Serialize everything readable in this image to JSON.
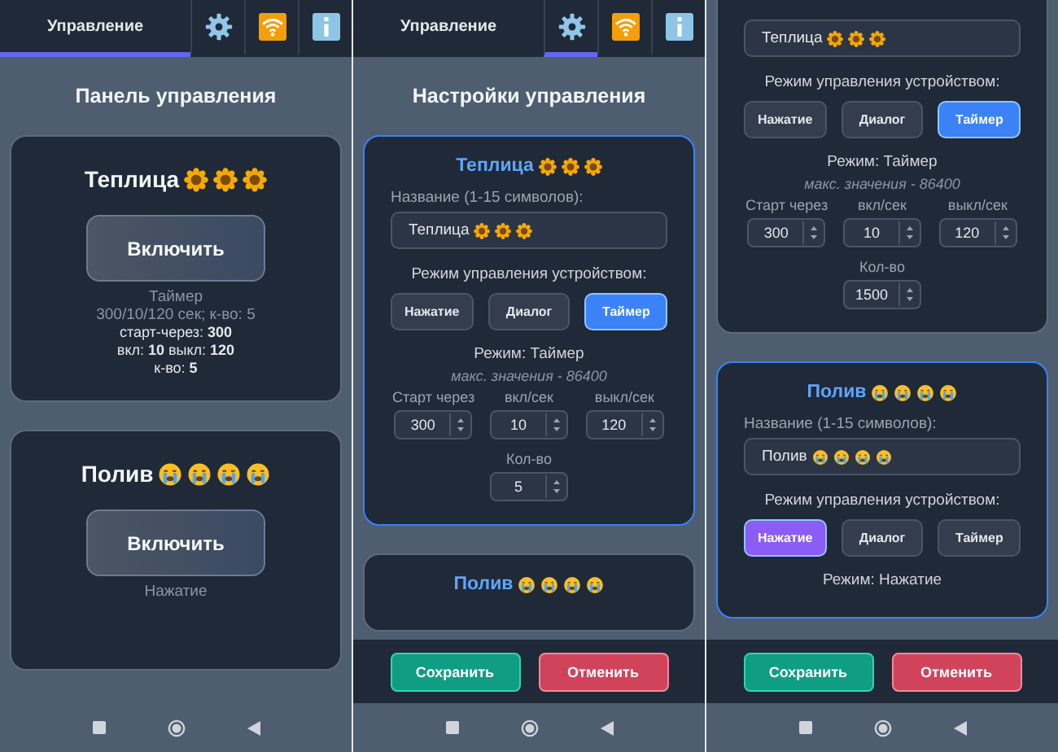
{
  "screens": [
    {
      "kind": "panel",
      "tabs": [
        {
          "kind": "text",
          "label": "Управление",
          "selected": true
        },
        {
          "kind": "gear",
          "selected": false
        },
        {
          "kind": "wifi",
          "selected": false
        },
        {
          "kind": "info",
          "selected": false
        }
      ],
      "title": "Панель управления",
      "devices": [
        {
          "name": "Теплица",
          "emoji": [
            {
              "kind": "sunflower"
            },
            {
              "kind": "sunflower"
            },
            {
              "kind": "sunflower"
            }
          ],
          "button": "Включить",
          "mode": "Таймер",
          "summary": "300/10/120 сек; к-во: 5",
          "details": [
            "старт-через: **300**",
            "вкл: **10** выкл: **120**",
            "к-во: **5**"
          ]
        },
        {
          "name": "Полив",
          "emoji": [
            {
              "kind": "crying"
            },
            {
              "kind": "crying"
            },
            {
              "kind": "crying"
            },
            {
              "kind": "crying"
            }
          ],
          "button": "Включить",
          "mode": "Нажатие"
        }
      ]
    },
    {
      "kind": "settings",
      "tabs": [
        {
          "kind": "text",
          "label": "Управление",
          "selected": false
        },
        {
          "kind": "gear",
          "selected": true
        },
        {
          "kind": "wifi",
          "selected": false
        },
        {
          "kind": "info",
          "selected": false
        }
      ],
      "title": "Настройки управления",
      "devices": [
        {
          "focused": true,
          "name": "Теплица",
          "emoji": [
            {
              "kind": "sunflower"
            },
            {
              "kind": "sunflower"
            },
            {
              "kind": "sunflower"
            }
          ],
          "name_label": "Название (1-15 символов):",
          "name_value": "Теплица",
          "name_value_emoji": [
            {
              "kind": "sunflower"
            },
            {
              "kind": "sunflower"
            },
            {
              "kind": "sunflower"
            }
          ],
          "mode_label": "Режим управления устройством:",
          "modes": [
            {
              "label": "Нажатие",
              "selected": false
            },
            {
              "label": "Диалог",
              "selected": false
            },
            {
              "label": "Таймер",
              "selected": true
            }
          ],
          "mode_text": "Режим: Таймер",
          "hint": "макс. значения - 86400",
          "fields": [
            {
              "label": "Старт через",
              "value": "300"
            },
            {
              "label": "вкл/сек",
              "value": "10"
            },
            {
              "label": "выкл/сек",
              "value": "120"
            }
          ],
          "count": {
            "label": "Кол-во",
            "value": "5"
          }
        },
        {
          "focused": false,
          "name": "Полив",
          "emoji": [
            {
              "kind": "crying"
            },
            {
              "kind": "crying"
            },
            {
              "kind": "crying"
            },
            {
              "kind": "crying"
            }
          ]
        }
      ],
      "footer": {
        "save": "Сохранить",
        "cancel": "Отменить"
      }
    },
    {
      "kind": "settings",
      "devices": [
        {
          "focused": false,
          "name_value": "Теплица",
          "name_value_emoji": [
            {
              "kind": "sunflower"
            },
            {
              "kind": "sunflower"
            },
            {
              "kind": "sunflower"
            }
          ],
          "mode_label": "Режим управления устройством:",
          "modes": [
            {
              "label": "Нажатие",
              "selected": false
            },
            {
              "label": "Диалог",
              "selected": false
            },
            {
              "label": "Таймер",
              "selected": true
            }
          ],
          "mode_text": "Режим: Таймер",
          "hint": "макс. значения - 86400",
          "fields": [
            {
              "label": "Старт через",
              "value": "300"
            },
            {
              "label": "вкл/сек",
              "value": "10"
            },
            {
              "label": "выкл/сек",
              "value": "120"
            }
          ],
          "count": {
            "label": "Кол-во",
            "value": "1500"
          }
        },
        {
          "focused": true,
          "name": "Полив",
          "emoji": [
            {
              "kind": "crying"
            },
            {
              "kind": "crying"
            },
            {
              "kind": "crying"
            },
            {
              "kind": "crying"
            }
          ],
          "name_label": "Название (1-15 символов):",
          "name_value": "Полив",
          "name_value_emoji": [
            {
              "kind": "crying"
            },
            {
              "kind": "crying"
            },
            {
              "kind": "crying"
            },
            {
              "kind": "crying"
            }
          ],
          "mode_label": "Режим управления устройством:",
          "modes": [
            {
              "label": "Нажатие",
              "selected": true
            },
            {
              "label": "Диалог",
              "selected": false
            },
            {
              "label": "Таймер",
              "selected": false
            }
          ],
          "mode_text": "Режим: Нажатие"
        }
      ],
      "footer": {
        "save": "Сохранить",
        "cancel": "Отменить"
      }
    }
  ]
}
